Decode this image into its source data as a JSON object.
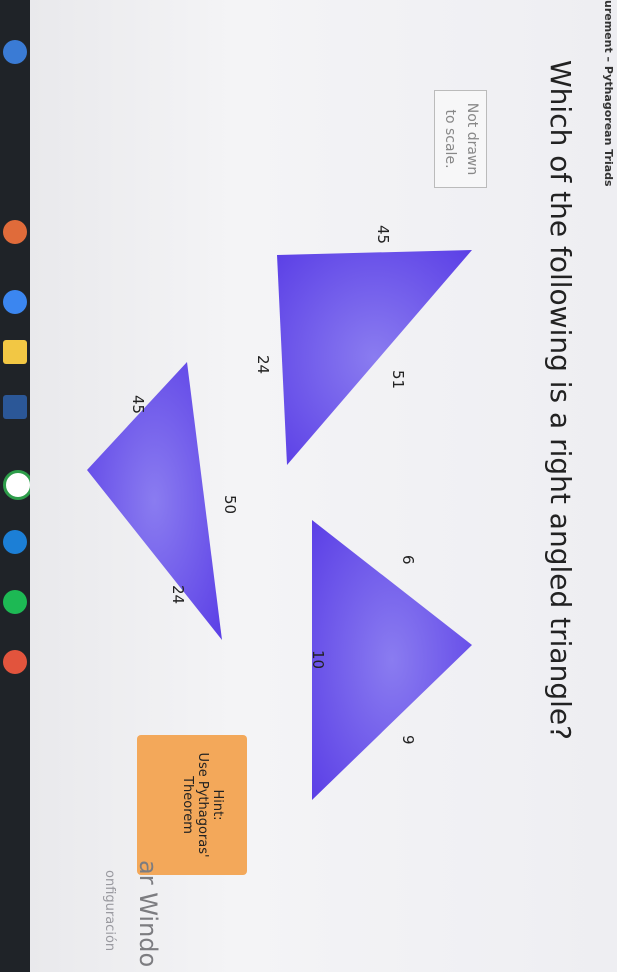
{
  "tab": {
    "title": "urement – Pythagorean Triads"
  },
  "question": "Which of the following is a right angled triangle?",
  "note": {
    "line1": "Not drawn",
    "line2": "to scale."
  },
  "triangles": [
    {
      "sides": [
        "45",
        "51",
        "24"
      ]
    },
    {
      "sides": [
        "24",
        "50",
        "45"
      ]
    },
    {
      "sides": [
        "6",
        "10",
        "9"
      ]
    }
  ],
  "hint": {
    "title": "Hint:",
    "line1": "Use Pythagoras'",
    "line2": "Theorem"
  },
  "windows": {
    "activate": "ar Windo",
    "config": "onfiguración"
  },
  "colors": {
    "triangle": "#6a4be8",
    "hint_bg": "#f3a85a",
    "taskbar": "#1f2328"
  }
}
